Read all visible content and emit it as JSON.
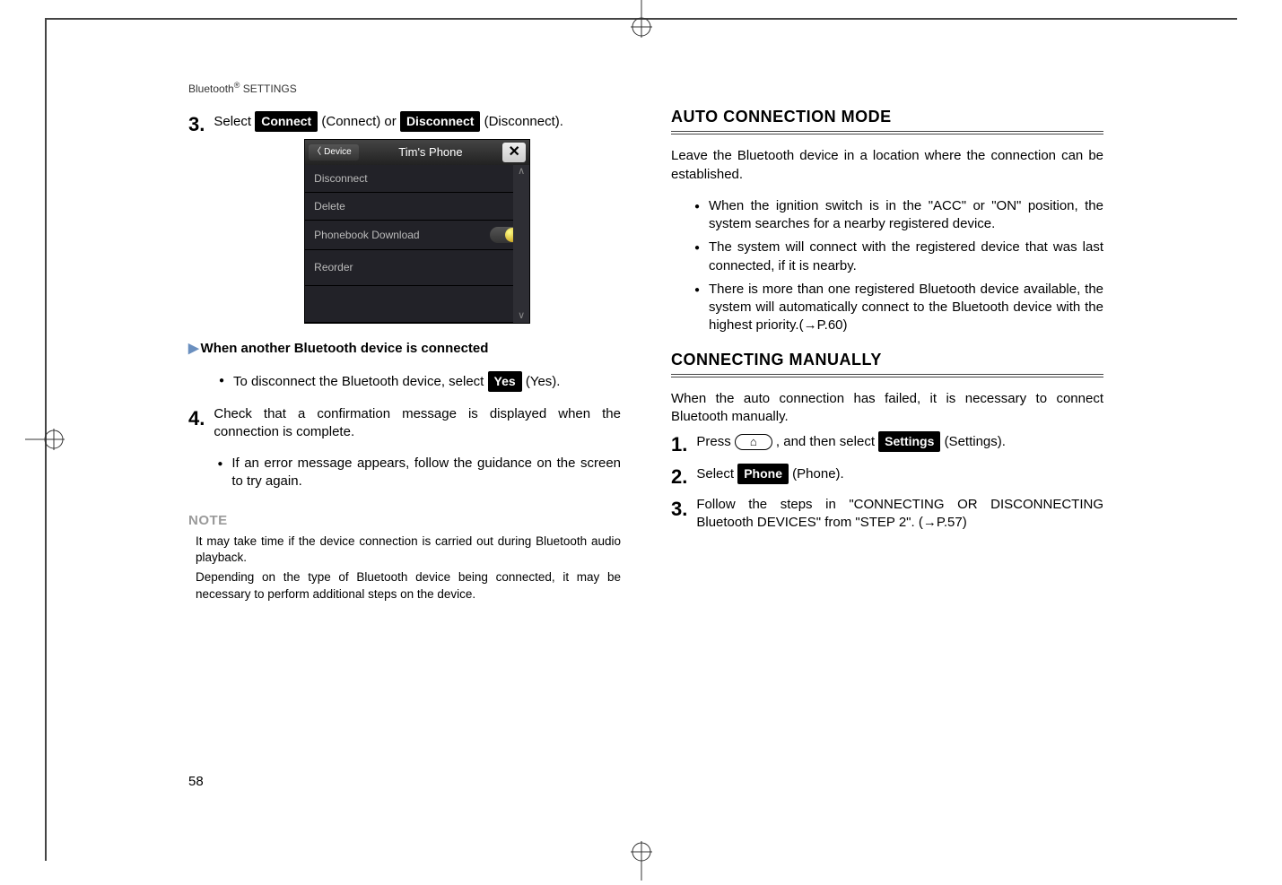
{
  "running_head_prefix": "Bluetooth",
  "running_head_suffix": " SETTINGS",
  "page_number": "58",
  "left": {
    "step3": {
      "num": "3.",
      "text_a": "Select ",
      "btn_connect": "Connect",
      "text_b": " (Connect) or ",
      "btn_disconnect": "Disconnect",
      "text_c": " (Disconnect)."
    },
    "screenshot": {
      "back_label": "Device",
      "title": "Tim's Phone",
      "close": "✕",
      "row1": "Disconnect",
      "row2": "Delete",
      "row3": "Phonebook Download",
      "row4": "Reorder",
      "scroll_up": "∧",
      "scroll_down": "∨"
    },
    "sub_connected": "When another Bluetooth device is connected",
    "sub_connected_bullet_a": "To disconnect the Bluetooth device, select ",
    "btn_yes": "Yes",
    "sub_connected_bullet_b": " (Yes).",
    "step4": {
      "num": "4.",
      "text": "Check that a confirmation message is displayed when the connection is complete.",
      "bullet": "If an error message appears, follow the guidance on the screen to try again."
    },
    "note_label": "NOTE",
    "note1": "It may take time if the device connection is carried out during Bluetooth audio playback.",
    "note2": "Depending on the type of Bluetooth device being connected, it may be necessary to perform additional steps on the device."
  },
  "right": {
    "h_auto": "AUTO CONNECTION MODE",
    "auto_intro": "Leave the Bluetooth device in a location where the connection can be established.",
    "auto_b1": "When the ignition switch is in the \"ACC\" or \"ON\" position, the system searches for a nearby registered device.",
    "auto_b2": "The system will connect with the registered device that was last connected, if it is nearby.",
    "auto_b3": "There is more than one registered Bluetooth device available, the system will automatically connect to the Bluetooth device with the highest priority.(→P.60)",
    "h_manual": "CONNECTING MANUALLY",
    "manual_intro": "When the auto connection has failed, it is necessary to connect Bluetooth manually.",
    "step1": {
      "num": "1.",
      "a": "Press ",
      "home_icon": "⌂",
      "b": ", and then select ",
      "btn_settings": "Settings",
      "c": " (Settings)."
    },
    "step2": {
      "num": "2.",
      "a": "Select ",
      "btn_phone": "Phone",
      "b": " (Phone)."
    },
    "step3b": {
      "num": "3.",
      "text": "Follow the steps in \"CONNECTING OR DISCONNECTING Bluetooth DEVICES\" from \"STEP 2\". (→P.57)"
    }
  }
}
